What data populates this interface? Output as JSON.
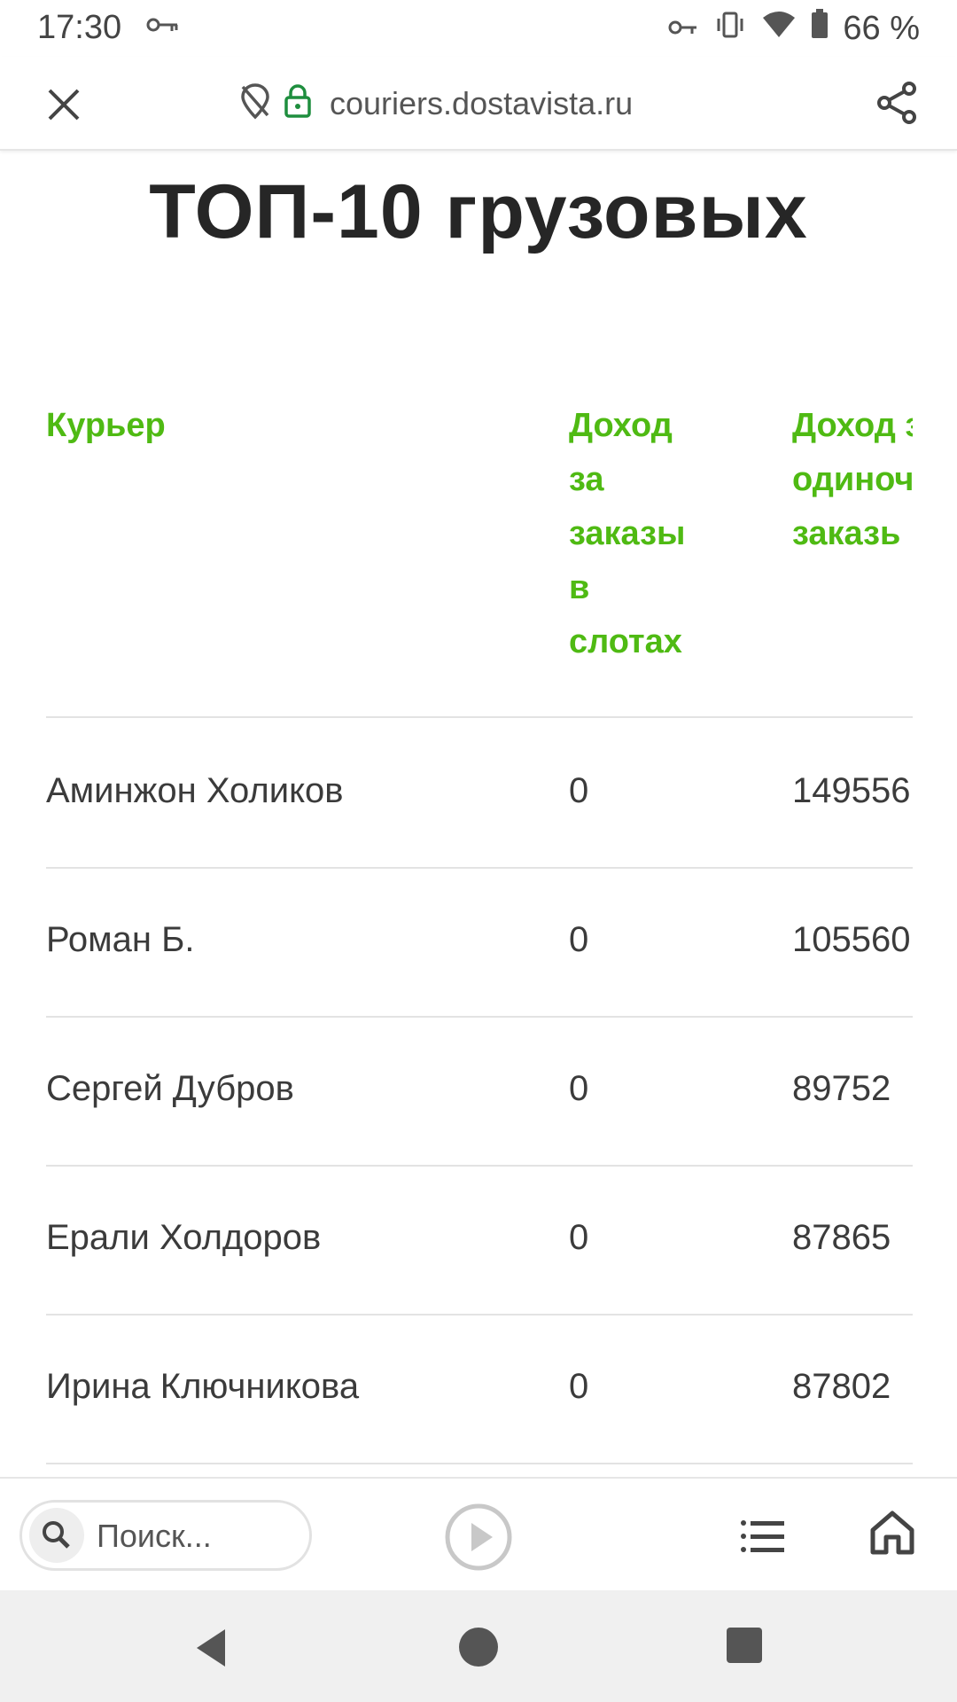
{
  "status_bar": {
    "time": "17:30",
    "battery": "66 %",
    "icons": [
      "vpn-key-icon",
      "vibrate-icon",
      "wifi-icon",
      "battery-icon"
    ]
  },
  "browser": {
    "url": "couriers.dostavista.ru",
    "icons": [
      "close-icon",
      "location-off-icon",
      "lock-icon",
      "share-icon"
    ]
  },
  "page": {
    "title": "ТОП-10 грузовых"
  },
  "table": {
    "headers": {
      "courier": "Курьер",
      "slot_income": [
        "Доход",
        "за",
        "заказы",
        "в",
        "слотах"
      ],
      "single_income": [
        "Доход з",
        "одиноч",
        "заказь"
      ]
    },
    "rows": [
      {
        "name": "Аминжон Холиков",
        "slot": "0",
        "single": "149556"
      },
      {
        "name": "Роман Б.",
        "slot": "0",
        "single": "105560"
      },
      {
        "name": "Сергей Дубров",
        "slot": "0",
        "single": "89752"
      },
      {
        "name": "Ерали Холдоров",
        "slot": "0",
        "single": "87865"
      },
      {
        "name": "Ирина Ключникова",
        "slot": "0",
        "single": "87802"
      }
    ]
  },
  "bottom_toolbar": {
    "search_placeholder": "Поиск...",
    "icons": [
      "search-icon",
      "play-icon",
      "list-icon",
      "home-icon"
    ]
  },
  "colors": {
    "accent": "#4fba13",
    "lock": "#1e8e3e",
    "text": "#2c2c2c"
  }
}
